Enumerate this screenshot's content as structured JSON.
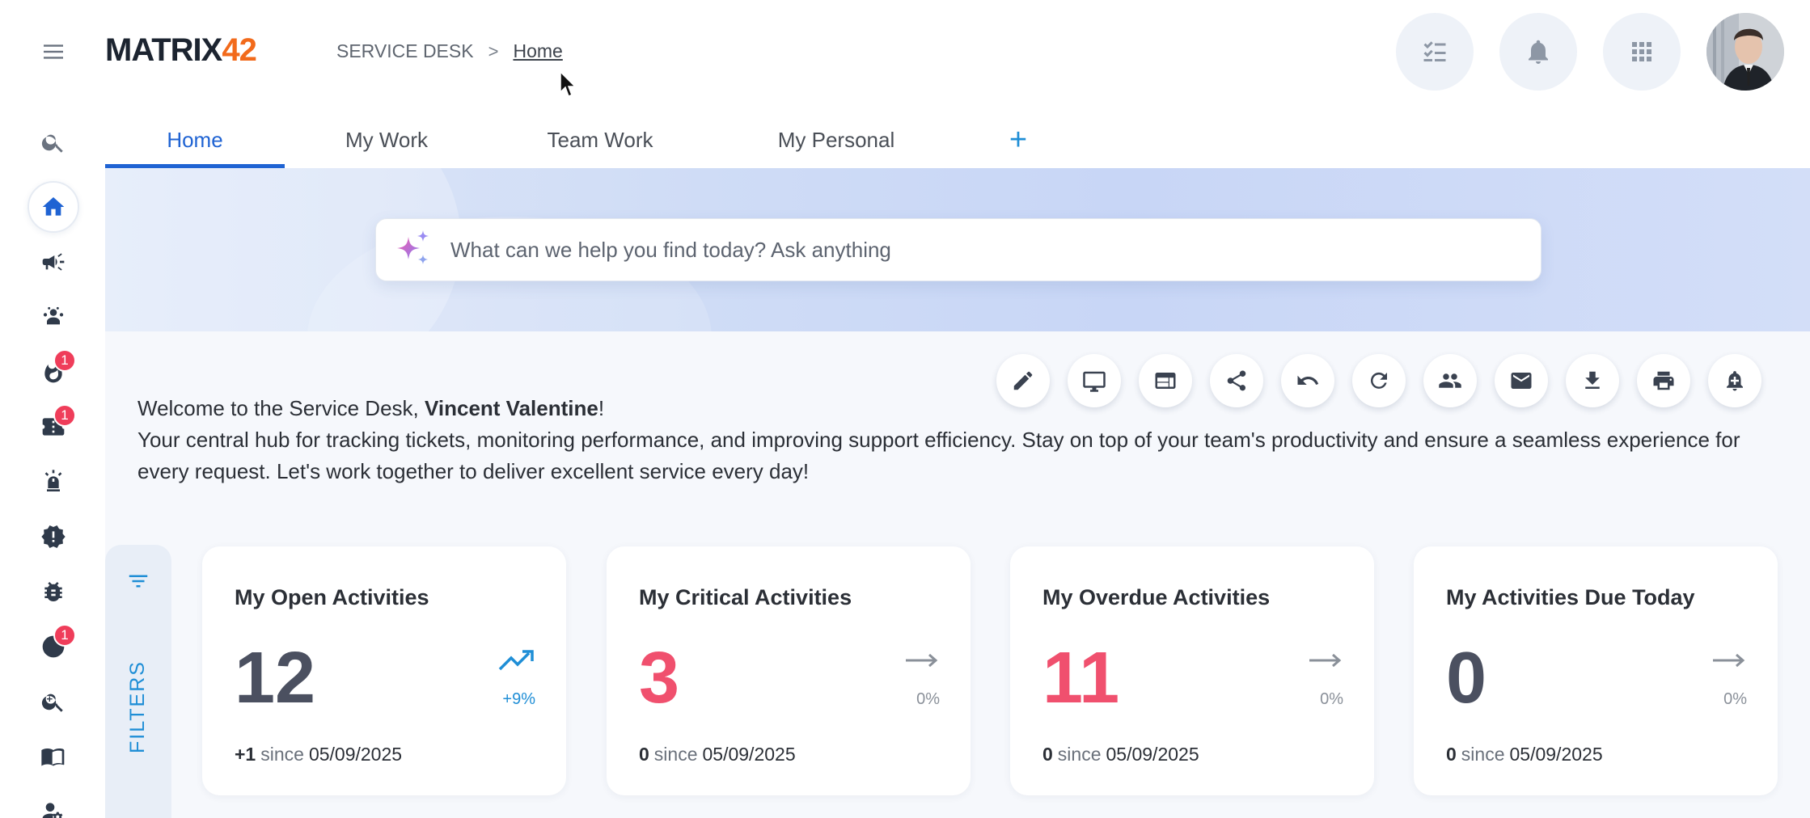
{
  "app": {
    "logo_part1": "MATRIX",
    "logo_part2": "42",
    "brand_accent": "#f26a1b",
    "primary_color": "#1f63d3"
  },
  "breadcrumb": {
    "root": "SERVICE DESK",
    "separator": ">",
    "current": "Home"
  },
  "header_icons": [
    "task-list-icon",
    "bell-icon",
    "apps-grid-icon"
  ],
  "sidebar": {
    "items": [
      {
        "icon": "menu-icon"
      },
      {
        "icon": "search-icon"
      },
      {
        "icon": "home-icon",
        "active": true
      },
      {
        "icon": "megaphone-icon"
      },
      {
        "icon": "team-icon"
      },
      {
        "icon": "fire-icon",
        "badge": "1"
      },
      {
        "icon": "ticket-icon",
        "badge": "1"
      },
      {
        "icon": "siren-icon"
      },
      {
        "icon": "alert-badge-icon"
      },
      {
        "icon": "bug-icon"
      },
      {
        "icon": "sync-icon",
        "badge": "1"
      },
      {
        "icon": "zoom-search-icon"
      },
      {
        "icon": "book-icon"
      },
      {
        "icon": "admin-settings-icon"
      }
    ]
  },
  "tabs": [
    {
      "label": "Home",
      "active": true
    },
    {
      "label": "My Work"
    },
    {
      "label": "Team Work"
    },
    {
      "label": "My Personal"
    }
  ],
  "tab_add_label": "+",
  "search": {
    "placeholder": "What can we help you find today? Ask anything"
  },
  "toolbar_icons": [
    "edit-icon",
    "monitor-icon",
    "layout-icon",
    "share-icon",
    "undo-icon",
    "refresh-icon",
    "people-icon",
    "mail-icon",
    "download-icon",
    "print-icon",
    "alert-bell-add-icon"
  ],
  "welcome": {
    "prefix": "Welcome to the Service Desk, ",
    "user": "Vincent Valentine",
    "suffix": "!",
    "body": "Your central hub for tracking tickets, monitoring performance, and improving support efficiency. Stay on top of your team's productivity and ensure a seamless experience for every request. Let's work together to deliver excellent service every day!"
  },
  "filters_label": "FILTERS",
  "cards": [
    {
      "title": "My Open Activities",
      "value": "12",
      "value_color": "#4b5060",
      "trend": "up",
      "trend_label": "+9%",
      "trend_color": "#1f8ed6",
      "delta": "+1",
      "since_word": "since",
      "date": "05/09/2025"
    },
    {
      "title": "My Critical Activities",
      "value": "3",
      "value_color": "#f0506e",
      "trend": "flat",
      "trend_label": "0%",
      "trend_color": "#8a9099",
      "delta": "0",
      "since_word": "since",
      "date": "05/09/2025"
    },
    {
      "title": "My Overdue Activities",
      "value": "11",
      "value_color": "#f0506e",
      "trend": "flat",
      "trend_label": "0%",
      "trend_color": "#8a9099",
      "delta": "0",
      "since_word": "since",
      "date": "05/09/2025"
    },
    {
      "title": "My Activities Due Today",
      "value": "0",
      "value_color": "#4b5060",
      "trend": "flat",
      "trend_label": "0%",
      "trend_color": "#8a9099",
      "delta": "0",
      "since_word": "since",
      "date": "05/09/2025"
    }
  ]
}
